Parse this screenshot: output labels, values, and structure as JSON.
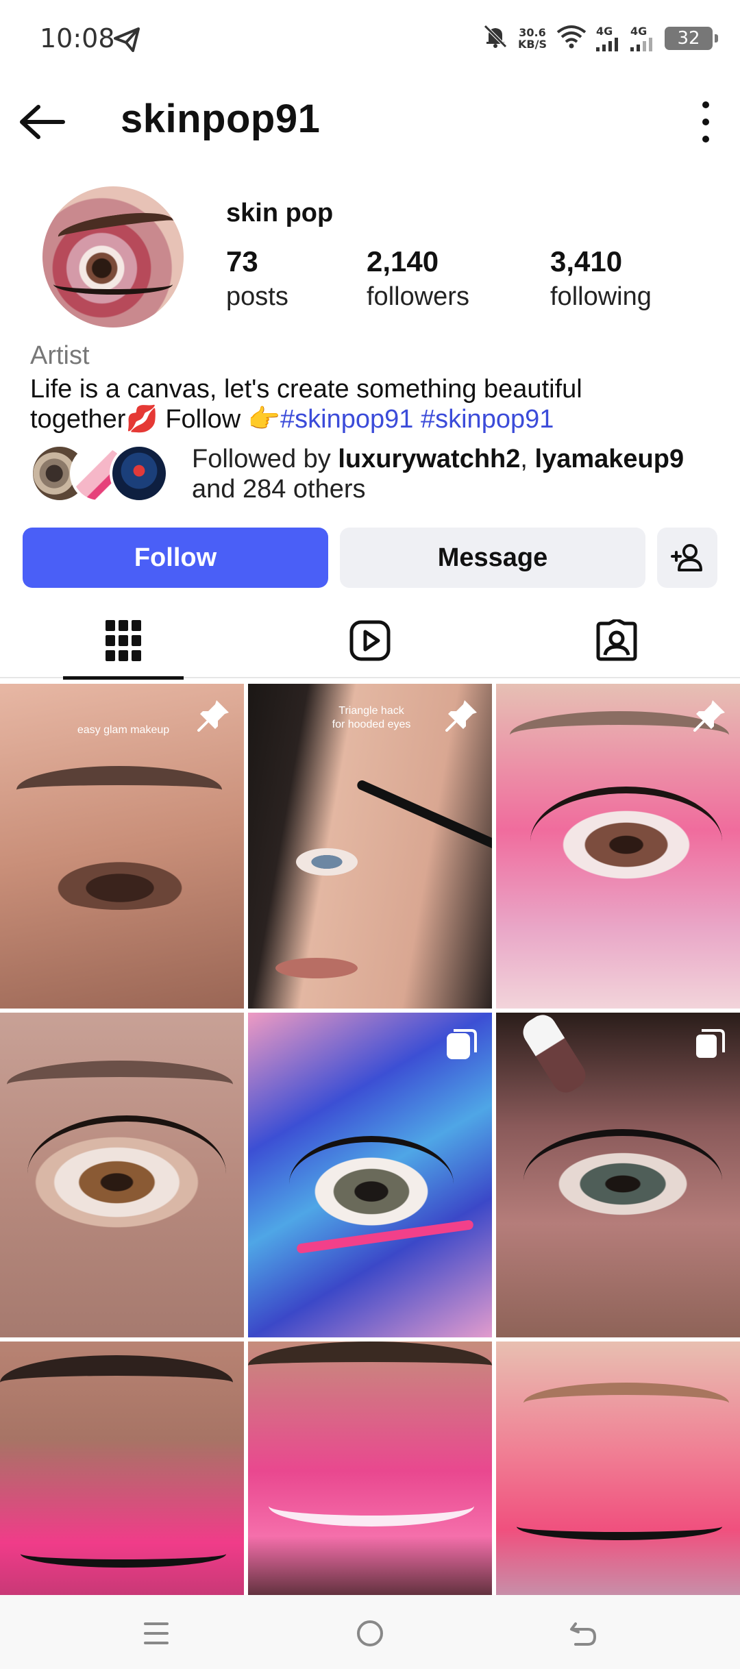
{
  "status_bar": {
    "time": "10:08",
    "net_speed_value": "30.6",
    "net_speed_unit": "KB/S",
    "signal_1": "4G",
    "signal_2": "4G",
    "battery": "32"
  },
  "header": {
    "username": "skinpop91"
  },
  "profile": {
    "display_name": "skin pop",
    "stats": [
      {
        "value": "73",
        "label": "posts"
      },
      {
        "value": "2,140",
        "label": "followers"
      },
      {
        "value": "3,410",
        "label": "following"
      }
    ],
    "category": "Artist",
    "bio_line1": "Life is a canvas, let's create something beautiful",
    "bio_line2_prefix": "together",
    "bio_emoji_lips": "💋",
    "bio_follow": " Follow ",
    "bio_emoji_point": "👉",
    "hashtag1": "#skinpop91",
    "hashtag2": "#skinpop91",
    "followed_by_prefix": "Followed by ",
    "followed_user1": "luxurywatchh2",
    "followed_sep": ", ",
    "followed_user2": "lyamakeup9",
    "followed_suffix": "and 284 others"
  },
  "actions": {
    "follow_label": "Follow",
    "message_label": "Message"
  },
  "tabs": [
    {
      "icon": "grid-icon",
      "active": true
    },
    {
      "icon": "reels-icon",
      "active": false
    },
    {
      "icon": "tagged-icon",
      "active": false
    }
  ],
  "grid": {
    "post1_caption": "easy glam makeup",
    "post2_caption_line1": "Triangle hack",
    "post2_caption_line2": "for hooded eyes",
    "badges": {
      "post1": "pin-icon",
      "post2": "pin-icon",
      "post3": "pin-icon",
      "post5": "multi-post-icon",
      "post6": "multi-post-icon"
    }
  },
  "colors": {
    "follow_button": "#4a5ff7",
    "hashtag": "#3b4bd9",
    "secondary_button": "#eff0f4"
  }
}
